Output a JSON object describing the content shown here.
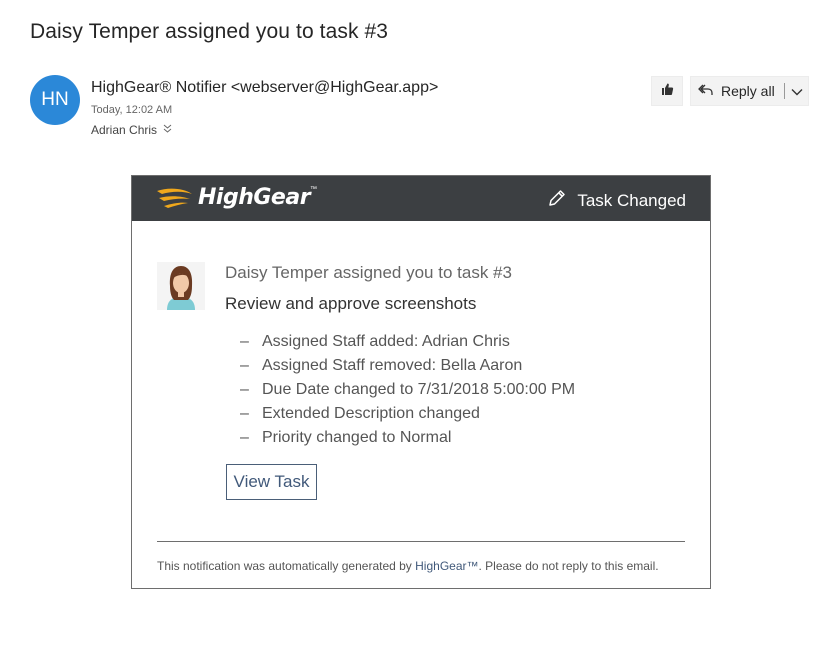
{
  "email": {
    "subject": "Daisy Temper assigned you to task #3",
    "avatar_initials": "HN",
    "sender": "HighGear® Notifier <webserver@HighGear.app>",
    "sent_time": "Today, 12:02 AM",
    "recipient": "Adrian Chris"
  },
  "actions": {
    "like_icon": "thumbs-up-icon",
    "reply_all_label": "Reply all"
  },
  "card": {
    "logo_text": "HighGear",
    "logo_tm": "™",
    "header_label": "Task Changed",
    "title": "Daisy Temper assigned you to task #3",
    "subtitle": "Review and approve screenshots",
    "changes": [
      "Assigned Staff added: Adrian Chris",
      "Assigned Staff removed: Bella Aaron",
      "Due Date changed to 7/31/2018 5:00:00 PM",
      "Extended Description changed",
      "Priority changed to Normal"
    ],
    "dash": "–",
    "view_button": "View Task",
    "footer_prefix": "This notification was automatically generated by ",
    "footer_brand": "HighGear™",
    "footer_suffix": ". Please do not reply to this email."
  },
  "colors": {
    "avatar": "#2b88d8",
    "header_bg": "#3c3f42",
    "logo_accent": "#f0a81c",
    "link": "#41597a"
  }
}
